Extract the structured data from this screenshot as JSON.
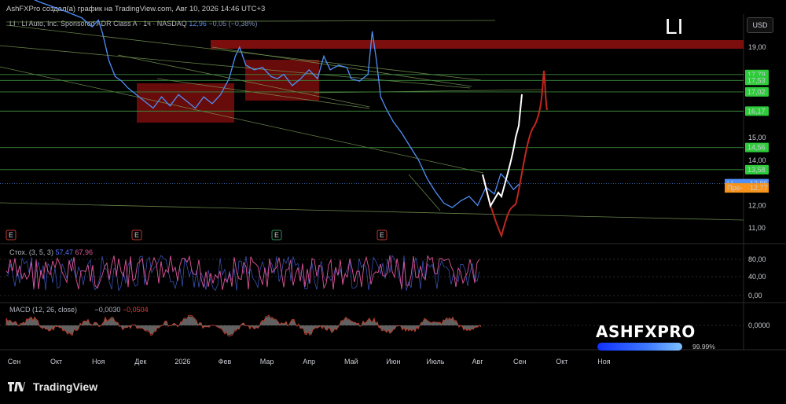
{
  "header": {
    "text": "AshFXPro создал(а) график на TradingView.com, Авг 10, 2026 14:46 UTC+3"
  },
  "symbol": {
    "title": "LI · Li Auto, Inc. Sponsored ADR Class A · 1ч · NASDAQ",
    "last": "12,96",
    "change": "−0,05 (−0,38%)",
    "ticker": "LI",
    "currency": "USD"
  },
  "colors": {
    "price": "#4f8ff5",
    "hline": "#3d8a3d",
    "zone": "#8b0f0f",
    "tagGreen": "#2ecc3b",
    "tagBlue": "#4f8ff5",
    "tagOrange": "#f7931a",
    "stoch": "#e0559a",
    "stochK": "#4f6ff5",
    "white": "#ffffff",
    "red": "#c0271f"
  },
  "price_axis": {
    "ticks": [
      "19,00",
      "15,00",
      "14,00",
      "12,00",
      "11,00"
    ],
    "levels": [
      {
        "label": "17,79",
        "value": 17.79
      },
      {
        "label": "17,53",
        "value": 17.53
      },
      {
        "label": "17,02",
        "value": 17.02
      },
      {
        "label": "16,17",
        "value": 16.17
      },
      {
        "label": "14,56",
        "value": 14.56
      },
      {
        "label": "13,58",
        "value": 13.58
      }
    ],
    "last_tag": {
      "prefix": "LI",
      "value": "12,96"
    },
    "pre_tag": {
      "prefix": "Пре-",
      "value": "12,77"
    }
  },
  "time_axis": {
    "labels": [
      "Сен",
      "Окт",
      "Ноя",
      "Дек",
      "2026",
      "Фев",
      "Мар",
      "Апр",
      "Май",
      "Июн",
      "Июль",
      "Авг",
      "Сен",
      "Окт",
      "Ноя"
    ]
  },
  "events": [
    "E",
    "E",
    "E",
    "E"
  ],
  "stoch": {
    "label": "Стох. (3, 5, 3)",
    "k": "57,47",
    "d": "67,96",
    "ticks": [
      "80,00",
      "40,00",
      "0,00"
    ]
  },
  "macd": {
    "label": "MACD (12, 26, close)",
    "v1": "−0,0030",
    "v2": "−0,0504",
    "tick": "0,0000"
  },
  "watermark": {
    "brand": "ASHFXPRO",
    "pct": "99.99%"
  },
  "footer": {
    "brand": "TradingView"
  },
  "chart_data": {
    "type": "line",
    "title": "",
    "xlabel": "",
    "ylabel": "",
    "ylim": [
      10.7,
      19.9
    ],
    "x": [
      "Сен",
      "Окт",
      "Ноя",
      "Дек",
      "2026",
      "Фев",
      "Мар",
      "Апр",
      "Май",
      "Июн",
      "Июль",
      "Авг"
    ],
    "series": [
      {
        "values": [
          [
            0,
            21.5
          ],
          [
            0.6,
            21.0
          ],
          [
            1.2,
            20.6
          ],
          [
            1.6,
            20.3
          ],
          [
            1.85,
            19.9
          ],
          [
            2.0,
            20.2
          ],
          [
            2.1,
            19.6
          ],
          [
            2.25,
            18.4
          ],
          [
            2.4,
            17.7
          ],
          [
            2.55,
            17.5
          ],
          [
            2.7,
            17.2
          ],
          [
            2.9,
            16.9
          ],
          [
            3.1,
            16.6
          ],
          [
            3.3,
            16.3
          ],
          [
            3.5,
            16.8
          ],
          [
            3.7,
            16.4
          ],
          [
            3.9,
            16.9
          ],
          [
            4.1,
            16.6
          ],
          [
            4.3,
            16.3
          ],
          [
            4.5,
            16.8
          ],
          [
            4.7,
            16.5
          ],
          [
            4.9,
            16.9
          ],
          [
            5.1,
            17.6
          ],
          [
            5.25,
            18.6
          ],
          [
            5.35,
            19.0
          ],
          [
            5.5,
            18.2
          ],
          [
            5.7,
            18.0
          ],
          [
            5.9,
            18.1
          ],
          [
            6.1,
            17.7
          ],
          [
            6.25,
            17.6
          ],
          [
            6.4,
            17.8
          ],
          [
            6.6,
            17.3
          ],
          [
            6.8,
            17.6
          ],
          [
            7.0,
            18.0
          ],
          [
            7.2,
            17.6
          ],
          [
            7.35,
            18.6
          ],
          [
            7.5,
            18.0
          ],
          [
            7.7,
            18.2
          ],
          [
            7.9,
            18.1
          ],
          [
            8.0,
            17.6
          ],
          [
            8.2,
            17.5
          ],
          [
            8.4,
            17.8
          ],
          [
            8.5,
            19.7
          ],
          [
            8.6,
            18.4
          ],
          [
            8.7,
            16.8
          ],
          [
            8.85,
            16.2
          ],
          [
            9.0,
            15.7
          ],
          [
            9.2,
            15.2
          ],
          [
            9.4,
            14.6
          ],
          [
            9.6,
            14.0
          ],
          [
            9.8,
            13.2
          ],
          [
            10.0,
            12.6
          ],
          [
            10.2,
            12.1
          ],
          [
            10.4,
            11.9
          ],
          [
            10.6,
            12.2
          ],
          [
            10.8,
            12.4
          ],
          [
            11.0,
            12.0
          ],
          [
            11.2,
            12.8
          ],
          [
            11.4,
            12.5
          ],
          [
            11.55,
            13.4
          ],
          [
            11.7,
            13.1
          ],
          [
            11.85,
            12.7
          ],
          [
            12.0,
            12.96
          ]
        ]
      }
    ]
  }
}
